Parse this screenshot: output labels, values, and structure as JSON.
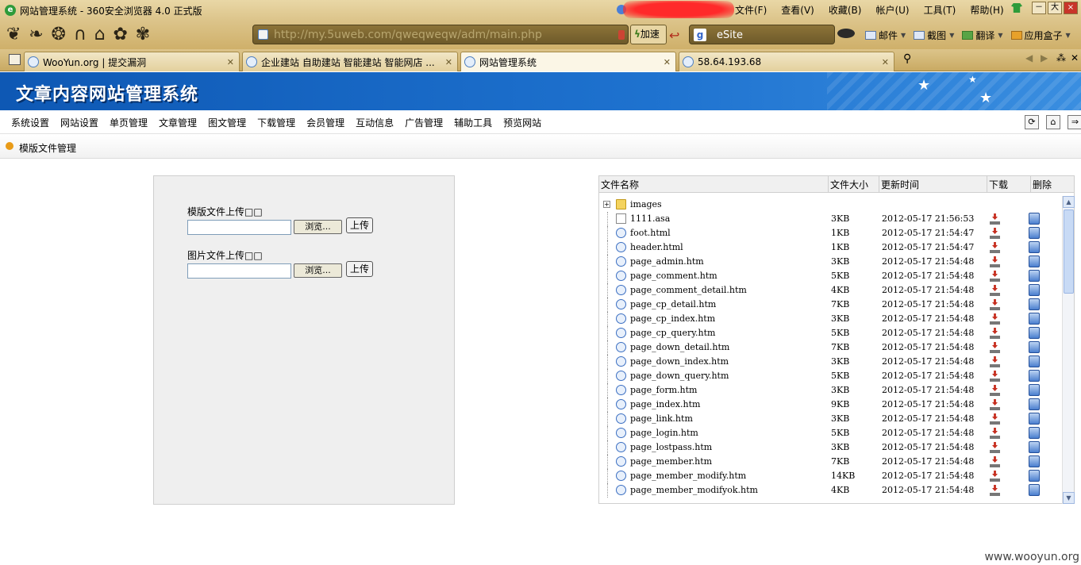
{
  "browser": {
    "window_title": "网站管理系统 - 360安全浏览器 4.0 正式版",
    "menu": [
      "文件(F)",
      "查看(V)",
      "收藏(B)",
      "帐户(U)",
      "工具(T)",
      "帮助(H)"
    ],
    "window_controls": [
      "－",
      "大",
      "×"
    ],
    "address_url": "http://my.5uweb.com/qweqweqw/adm/main.php",
    "accelerate_label": "加速",
    "search_engine_label": "eSite",
    "tools": [
      {
        "label": "邮件",
        "icon": "mail-icon"
      },
      {
        "label": "截图",
        "icon": "screenshot-icon"
      },
      {
        "label": "翻译",
        "icon": "translate-icon"
      },
      {
        "label": "应用盒子",
        "icon": "appbox-icon"
      }
    ],
    "tabs": [
      {
        "title": "WooYun.org | 提交漏洞",
        "active": false
      },
      {
        "title": "企业建站 自助建站 智能建站 智能网店 ...",
        "active": false
      },
      {
        "title": "网站管理系统",
        "active": true
      },
      {
        "title": "58.64.193.68",
        "active": false
      }
    ]
  },
  "cms": {
    "site_title": "文章内容网站管理系统",
    "nav": [
      "系统设置",
      "网站设置",
      "单页管理",
      "文章管理",
      "图文管理",
      "下载管理",
      "会员管理",
      "互动信息",
      "广告管理",
      "辅助工具",
      "预览网站"
    ],
    "breadcrumb": "模版文件管理",
    "upload": {
      "template_label": "模版文件上传□□",
      "image_label": "图片文件上传□□",
      "browse_label": "浏览...",
      "upload_label": "上传"
    },
    "file_table": {
      "columns": [
        "文件名称",
        "文件大小",
        "更新时间",
        "下载",
        "删除"
      ],
      "rows": [
        {
          "name": "images",
          "size": "",
          "time": "",
          "type": "folder"
        },
        {
          "name": "1111.asa",
          "size": "3KB",
          "time": "2012-05-17 21:56:53",
          "type": "file"
        },
        {
          "name": "foot.html",
          "size": "1KB",
          "time": "2012-05-17 21:54:47",
          "type": "html"
        },
        {
          "name": "header.html",
          "size": "1KB",
          "time": "2012-05-17 21:54:47",
          "type": "html"
        },
        {
          "name": "page_admin.htm",
          "size": "3KB",
          "time": "2012-05-17 21:54:48",
          "type": "html"
        },
        {
          "name": "page_comment.htm",
          "size": "5KB",
          "time": "2012-05-17 21:54:48",
          "type": "html"
        },
        {
          "name": "page_comment_detail.htm",
          "size": "4KB",
          "time": "2012-05-17 21:54:48",
          "type": "html"
        },
        {
          "name": "page_cp_detail.htm",
          "size": "7KB",
          "time": "2012-05-17 21:54:48",
          "type": "html"
        },
        {
          "name": "page_cp_index.htm",
          "size": "3KB",
          "time": "2012-05-17 21:54:48",
          "type": "html"
        },
        {
          "name": "page_cp_query.htm",
          "size": "5KB",
          "time": "2012-05-17 21:54:48",
          "type": "html"
        },
        {
          "name": "page_down_detail.htm",
          "size": "7KB",
          "time": "2012-05-17 21:54:48",
          "type": "html"
        },
        {
          "name": "page_down_index.htm",
          "size": "3KB",
          "time": "2012-05-17 21:54:48",
          "type": "html"
        },
        {
          "name": "page_down_query.htm",
          "size": "5KB",
          "time": "2012-05-17 21:54:48",
          "type": "html"
        },
        {
          "name": "page_form.htm",
          "size": "3KB",
          "time": "2012-05-17 21:54:48",
          "type": "html"
        },
        {
          "name": "page_index.htm",
          "size": "9KB",
          "time": "2012-05-17 21:54:48",
          "type": "html"
        },
        {
          "name": "page_link.htm",
          "size": "3KB",
          "time": "2012-05-17 21:54:48",
          "type": "html"
        },
        {
          "name": "page_login.htm",
          "size": "5KB",
          "time": "2012-05-17 21:54:48",
          "type": "html"
        },
        {
          "name": "page_lostpass.htm",
          "size": "3KB",
          "time": "2012-05-17 21:54:48",
          "type": "html"
        },
        {
          "name": "page_member.htm",
          "size": "7KB",
          "time": "2012-05-17 21:54:48",
          "type": "html"
        },
        {
          "name": "page_member_modify.htm",
          "size": "14KB",
          "time": "2012-05-17 21:54:48",
          "type": "html"
        },
        {
          "name": "page_member_modifyok.htm",
          "size": "4KB",
          "time": "2012-05-17 21:54:48",
          "type": "html"
        }
      ]
    }
  },
  "watermark": "www.wooyun.org"
}
